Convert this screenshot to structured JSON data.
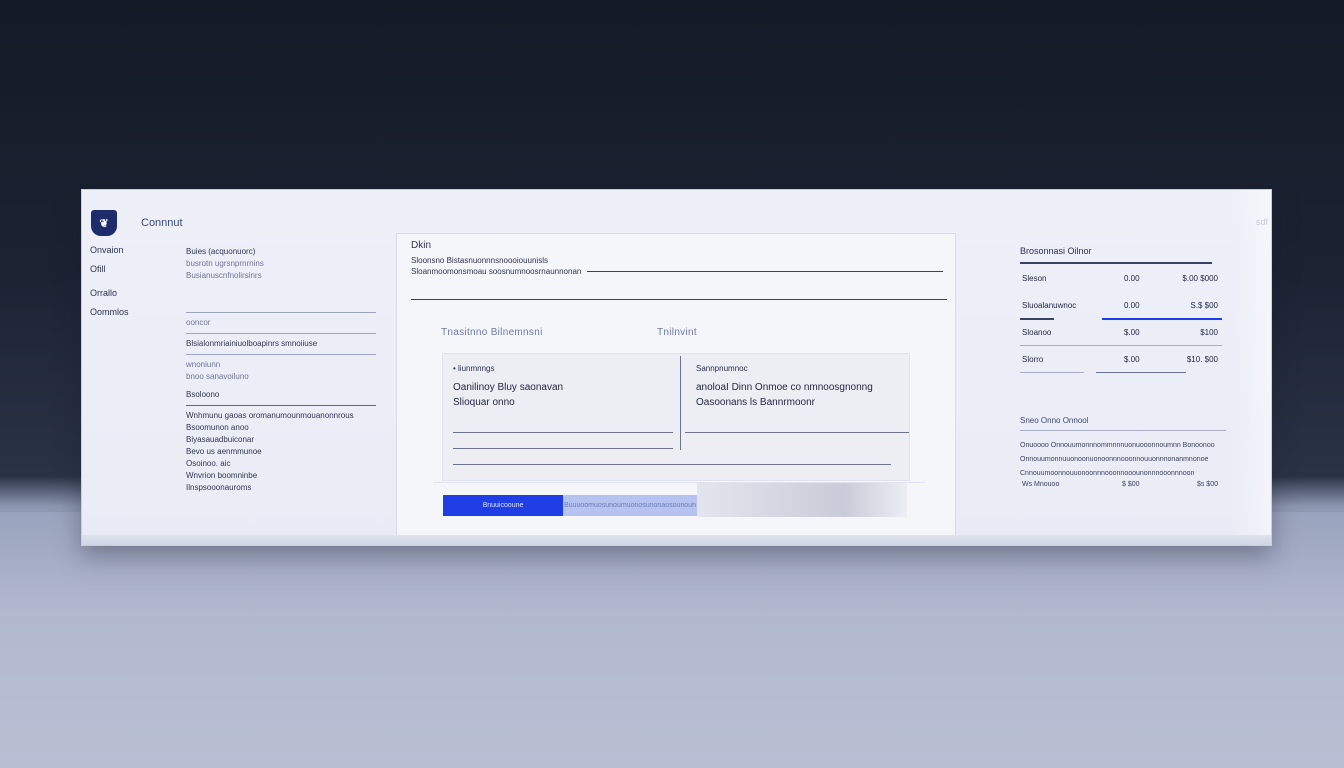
{
  "app": {
    "brand": "Connnut",
    "logo_glyph": "❦",
    "corner_label": "sdf"
  },
  "nav": {
    "items": [
      "Onvaion",
      "Ofill",
      "Orrallo",
      "Oommlos"
    ]
  },
  "details": {
    "rows": [
      "Buies (acquonuorc)",
      "busrotn ugrsnprnrnins",
      "Busianuscnfnolirsinrs",
      "ooncor",
      "Blsialonmriainiuolboapinrs smnoiiuse",
      "wnoniunn",
      "bnoo sanavoiluno",
      "Bsoloono",
      "Wnhmunu gaoas  oromanumounmouanonnrous",
      "Bsoomunon  anoo",
      "Biyasauadbuiconar",
      "Bevo us aenmmunoe",
      "Osoinoo. aic",
      "Wnvrion boomninbe",
      "Ilnspsooonauroms"
    ]
  },
  "doc": {
    "title": "Dkin",
    "subtitle": "Sloonsno Bistasnuonnnsnoooiouunisls",
    "subtitle2": "Sloanmoomonsmoau soosnumnoosrnaunnonan",
    "tabs": [
      "Tnasitnno Bilnemnsni",
      "Tnilnvint"
    ],
    "left_cell": {
      "label": "• liunmnngs",
      "lines": [
        "Oanilinoy Bluy saonavan",
        "Slioquar onno"
      ]
    },
    "right_cell": {
      "label": "Sannpnumnoc",
      "lines": [
        "anoloaI Dinn Onmoe co nmnoosgnonng",
        "Oasoonans ls  Bannrmoonr"
      ]
    },
    "primary_button": "Bnuuicooune",
    "secondary_button": "Buuuoomuosunoumuonosunonaosounoun"
  },
  "summary": {
    "title": "Brosonnasi Oilnor",
    "rows": [
      {
        "name": "Sleson",
        "qty": "0.00",
        "amount": "$.00 $000"
      },
      {
        "name": "Sluoalanuwnoc",
        "qty": "0.00",
        "amount": "S.$ $00"
      },
      {
        "name": "Sloanoo",
        "qty": "$.00",
        "amount": "$100"
      },
      {
        "name": "Slorro",
        "qty": "$.00",
        "amount": "$10. $00"
      }
    ],
    "accent_color": "#1f3ee6"
  },
  "notes": {
    "header": "Sneo Onno   Onnool",
    "lines": [
      "Onuoooo Onnouumonnnommnnnuonuooonnoumnn Bonoonoo",
      "Onnouumonnuuonoonuonoonnnooonnouuonnnonanmnonoe",
      "Cnnouumoonnouuonoonnnooonnooounonnnooonnnoon"
    ],
    "footer": {
      "left": "Ws Mnouoo",
      "mid": "$ $00",
      "right": "$s $00"
    }
  }
}
